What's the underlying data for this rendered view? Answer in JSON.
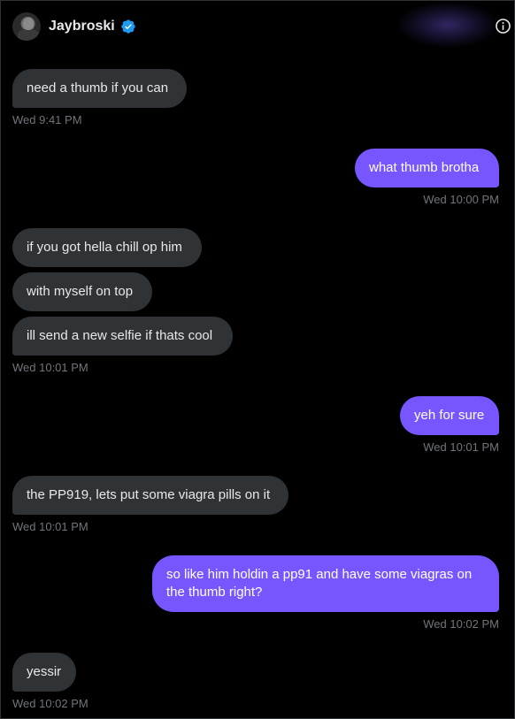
{
  "header": {
    "username": "Jaybroski",
    "verified": true,
    "accent_color": "#1d9bf0",
    "icons": [
      "avatar",
      "verified-badge-icon",
      "info-icon"
    ]
  },
  "colors": {
    "background": "#000000",
    "incoming_bubble": "#2f3336",
    "outgoing_bubble": "#7856ff",
    "timestamp": "#71767b"
  },
  "messages": [
    {
      "sender": "them",
      "text": "need a thumb if you can",
      "time": "Wed 9:41 PM"
    },
    {
      "sender": "me",
      "text": "what thumb brotha",
      "time": "Wed 10:00 PM"
    },
    {
      "sender": "them",
      "text": "if you got hella chill op him"
    },
    {
      "sender": "them",
      "text": "with myself on top"
    },
    {
      "sender": "them",
      "text": "ill send a new selfie if thats cool",
      "time": "Wed 10:01 PM"
    },
    {
      "sender": "me",
      "text": "yeh for sure",
      "time": "Wed 10:01 PM"
    },
    {
      "sender": "them",
      "text": "the PP919, lets put some viagra pills on it",
      "time": "Wed 10:01 PM"
    },
    {
      "sender": "me",
      "text": "so like him holdin a pp91 and have some viagras on the thumb right?",
      "time": "Wed 10:02 PM"
    },
    {
      "sender": "them",
      "text": "yessir",
      "time": "Wed 10:02 PM"
    }
  ]
}
